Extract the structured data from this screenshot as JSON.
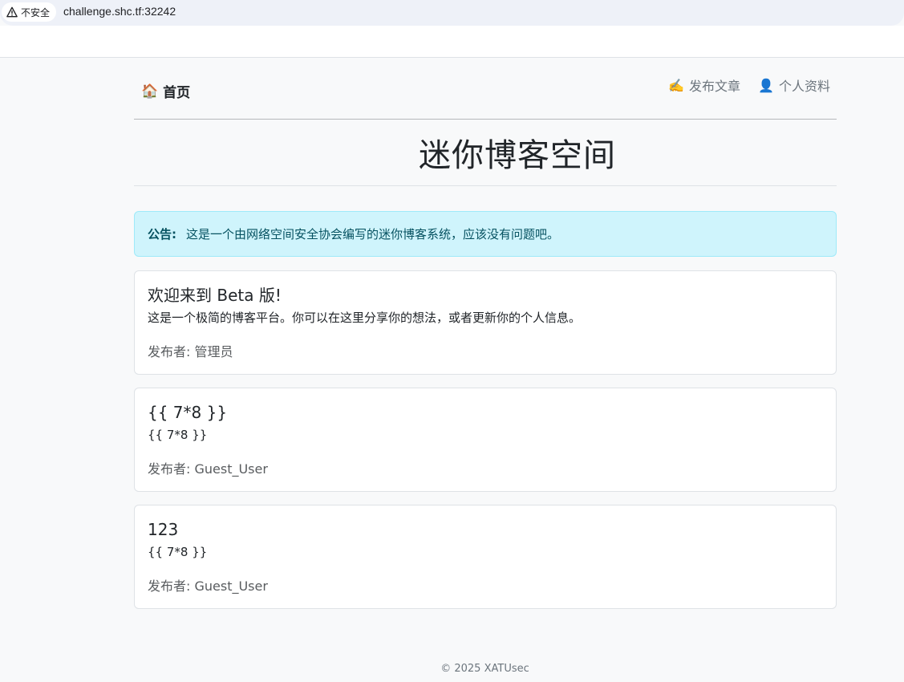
{
  "browser": {
    "security_label": "不安全",
    "url": "challenge.shc.tf:32242"
  },
  "nav": {
    "brand_icon": "🏠",
    "brand_label": "首页",
    "links": [
      {
        "icon": "✍️",
        "label": "发布文章"
      },
      {
        "icon": "👤",
        "label": "个人资料"
      }
    ]
  },
  "header": {
    "title": "迷你博客空间"
  },
  "notice": {
    "label": "公告:",
    "text": "这是一个由网络空间安全协会编写的迷你博客系统，应该没有问题吧。"
  },
  "posts": [
    {
      "title": "欢迎来到 Beta 版!",
      "content": "这是一个极简的博客平台。你可以在这里分享你的想法，或者更新你的个人信息。",
      "author": "发布者: 管理员"
    },
    {
      "title": "{{ 7*8 }}",
      "content": "{{ 7*8 }}",
      "author": "发布者: Guest_User"
    },
    {
      "title": "123",
      "content": "{{ 7*8 }}",
      "author": "发布者: Guest_User"
    }
  ],
  "footer": {
    "text": "© 2025 XATUsec"
  }
}
